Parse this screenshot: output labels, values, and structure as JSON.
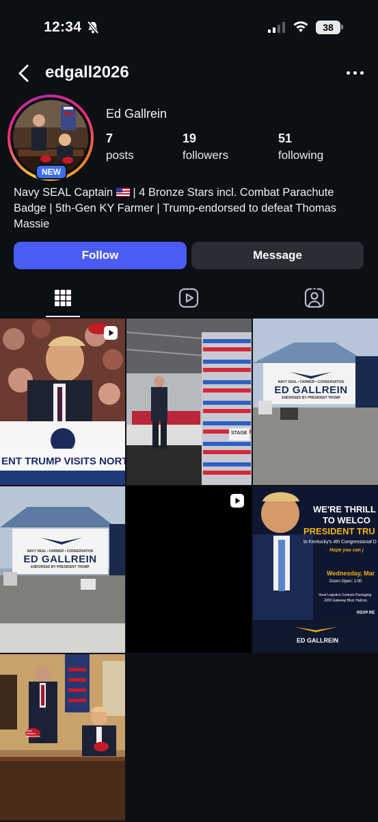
{
  "status_bar": {
    "time": "12:34",
    "battery": "38"
  },
  "header": {
    "username": "edgall2026"
  },
  "profile": {
    "display_name": "Ed Gallrein",
    "badge": "NEW",
    "stats": [
      {
        "value": "7",
        "label": "posts"
      },
      {
        "value": "19",
        "label": "followers"
      },
      {
        "value": "51",
        "label": "following"
      }
    ],
    "bio_part1": "Navy SEAL Captain ",
    "bio_part2": " | 4 Bronze Stars incl. Combat Parachute Badge | 5th-Gen KY Farmer | Trump-endorsed to defeat Thomas Massie"
  },
  "buttons": {
    "follow": "Follow",
    "message": "Message"
  },
  "posts": {
    "p1_caption": "ENT TRUMP VISITS NORTHE",
    "p2_sign": "STAGE",
    "banner_line1": "NAVY SEAL • FARMER • CONSERVATIVE",
    "banner_name": "ED GALLREIN",
    "banner_line2": "ENDORSED BY PRESIDENT TRUMP",
    "p6_headline1": "WE'RE THRILL",
    "p6_headline2": "TO WELCO",
    "p6_headline3": "PRESIDENT TRU",
    "p6_sub": "to Kentucky's 4th Congressional D",
    "p6_hope": "Hope you can j",
    "p6_date": "Wednesday, Mar",
    "p6_doors": "Doors Open: 1:00",
    "p6_venue1": "Verst Logistics Contract Packaging",
    "p6_venue2": "2200 Gateway Blvd, Hebron,",
    "p6_rsvp": "RSVP RE",
    "hat_text": "MAKE AMERICA GREAT AGAIN"
  }
}
